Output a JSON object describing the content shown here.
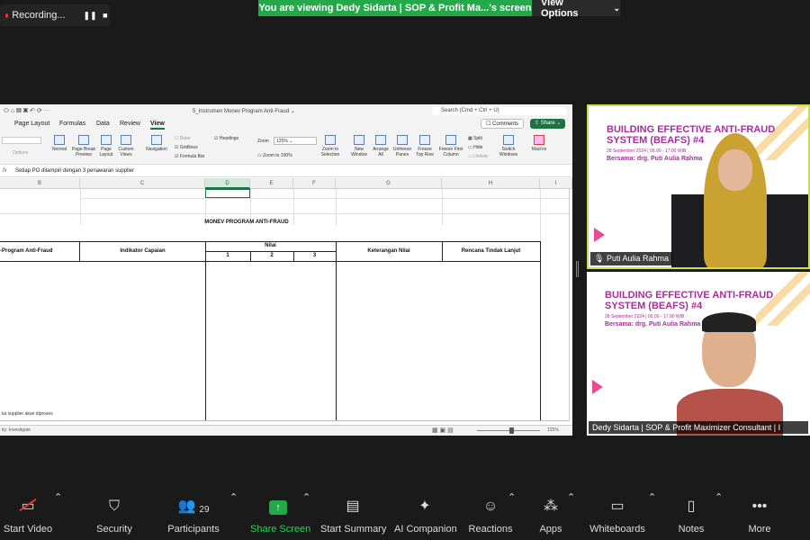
{
  "top": {
    "recording_label": "Recording...",
    "viewing_banner": "You are viewing Dedy Sidarta | SOP & Profit Ma...'s screen",
    "view_options": "View Options"
  },
  "excel": {
    "title": "5_Instrumen Monev Program Anti-Fraud ⌄",
    "search": "Search (Cmd + Ctrl + U)",
    "tabs": [
      "Page Layout",
      "Formulas",
      "Data",
      "Review",
      "View"
    ],
    "comments": "Comments",
    "share": "Share",
    "ribbon": {
      "normal": "Normal",
      "page_break": "Page Break Preview",
      "page_layout": "Page Layout",
      "custom_views": "Custom Views",
      "navigation": "Navigation",
      "ruler": "Ruler",
      "gridlines": "Gridlines",
      "formula_bar": "Formula Bar",
      "headings": "Headings",
      "zoom": "Zoom",
      "zoom_value": "125%",
      "zoom_100": "Zoom to 100%",
      "zoom_selection": "Zoom to Selection",
      "new_window": "New Window",
      "arrange_all": "Arrange All",
      "unfreeze": "Unfreeze Panes",
      "freeze_top": "Freeze Top Row",
      "freeze_first": "Freeze First Column",
      "split": "Split",
      "hide": "Hide",
      "unhide": "Unhide",
      "switch": "Switch Windows",
      "macros": "Macros",
      "options": "Options"
    },
    "formula_fx": "fx",
    "formula_text": "Setiap PO dilampiri dengan 3 penawaran supplier",
    "columns": [
      "B",
      "C",
      "D",
      "E",
      "F",
      "G",
      "H",
      "I"
    ],
    "sheet_title": "MONEV PROGRAM ANTI-FRAUD",
    "headers": {
      "program": "-Program Anti-Fraud",
      "indikator": "Indikator Capaian",
      "nilai": "Nilai",
      "n1": "1",
      "n2": "2",
      "n3": "3",
      "keterangan": "Keterangan Nilai",
      "rencana": "Rencana Tindak Lanjut"
    },
    "row_cut_text": "ka supplier akan diproses",
    "status_left": "ity: Investigate",
    "zoom_status": "125%"
  },
  "tiles": [
    {
      "event_title": "BUILDING EFFECTIVE ANTI-FRAUD SYSTEM (BEAFS) #4",
      "event_date": "28 September 2024 | 09.00 - 17.00 WIB",
      "event_with": "Bersama: drg. Puti Aulia Rahma",
      "name": "Puti Aulia Rahma"
    },
    {
      "event_title": "BUILDING EFFECTIVE ANTI-FRAUD SYSTEM (BEAFS) #4",
      "event_date": "28 September 2024 | 09.00 - 17.00 WIB",
      "event_with": "Bersama: drg. Puti Aulia Rahma",
      "name": "Dedy Sidarta | SOP & Profit Maximizer Consultant | I"
    }
  ],
  "toolbar": {
    "start_video": "Start Video",
    "security": "Security",
    "participants": "Participants",
    "participants_count": "29",
    "share_screen": "Share Screen",
    "start_summary": "Start Summary",
    "ai_companion": "AI Companion",
    "reactions": "Reactions",
    "apps": "Apps",
    "whiteboards": "Whiteboards",
    "notes": "Notes",
    "more": "More"
  }
}
